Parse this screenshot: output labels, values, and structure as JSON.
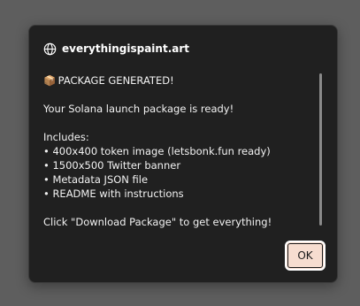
{
  "dialog": {
    "origin": "everythingispaint.art",
    "icons": {
      "origin": "globe-icon",
      "title": "package-icon"
    },
    "message": {
      "title_icon": "📦",
      "title": "PACKAGE GENERATED!",
      "intro": "Your Solana launch package is ready!",
      "includes_label": "Includes:",
      "items": [
        "• 400x400 token image (letsbonk.fun ready)",
        "• 1500x500 Twitter banner",
        "• Metadata JSON file",
        "• README with instructions"
      ],
      "footer": "Click \"Download Package\" to get everything!"
    },
    "ok_label": "OK"
  }
}
